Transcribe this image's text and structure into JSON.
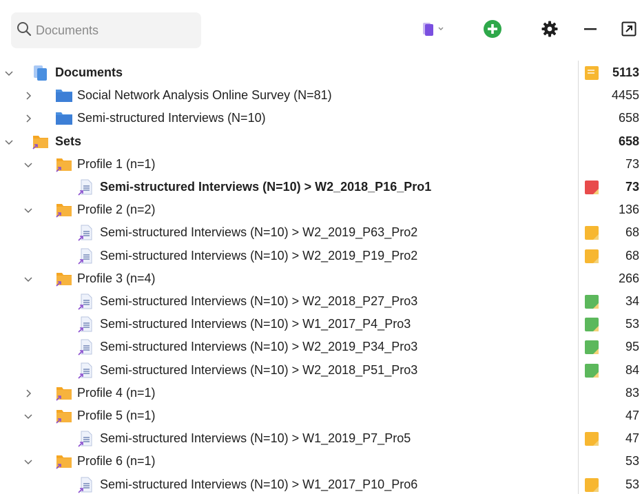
{
  "search": {
    "placeholder": "Documents"
  },
  "toolbar": {
    "doc_icon": "document-dropdown-icon",
    "add_icon": "add-circle-icon",
    "settings_icon": "gear-icon",
    "minimize_icon": "minus-icon",
    "popout_icon": "popout-icon"
  },
  "colors": {
    "folder_blue": "#4a8fe0",
    "folder_orange": "#f5a623",
    "memo_yellow": "#f7b731",
    "memo_red": "#e84b4b",
    "memo_green": "#5cb85c",
    "add_green": "#2ea84a",
    "link_purple": "#8b4fcf"
  },
  "tree": {
    "rows": [
      {
        "level": 0,
        "expand": "open",
        "icon": "documents",
        "label": "Documents",
        "count": "5113",
        "bold": true,
        "memo": "yellow"
      },
      {
        "level": 1,
        "expand": "closed",
        "icon": "folder-blue",
        "label": "Social Network Analysis Online Survey (N=81)",
        "count": "4455",
        "bold": false,
        "memo": ""
      },
      {
        "level": 1,
        "expand": "closed",
        "icon": "folder-blue",
        "label": "Semi-structured Interviews (N=10)",
        "count": "658",
        "bold": false,
        "memo": ""
      },
      {
        "level": 0,
        "expand": "open",
        "icon": "set",
        "label": "Sets",
        "count": "658",
        "bold": true,
        "memo": ""
      },
      {
        "level": 1,
        "expand": "open",
        "icon": "set",
        "label": "Profile 1 (n=1)",
        "count": "73",
        "bold": false,
        "memo": ""
      },
      {
        "level": 2,
        "expand": "",
        "icon": "doc",
        "label": "Semi-structured Interviews (N=10) > W2_2018_P16_Pro1",
        "count": "73",
        "bold": true,
        "memo": "red"
      },
      {
        "level": 1,
        "expand": "open",
        "icon": "set",
        "label": "Profile 2 (n=2)",
        "count": "136",
        "bold": false,
        "memo": ""
      },
      {
        "level": 2,
        "expand": "",
        "icon": "doc",
        "label": "Semi-structured Interviews (N=10) > W2_2019_P63_Pro2",
        "count": "68",
        "bold": false,
        "memo": "yellow"
      },
      {
        "level": 2,
        "expand": "",
        "icon": "doc",
        "label": "Semi-structured Interviews (N=10) > W2_2019_P19_Pro2",
        "count": "68",
        "bold": false,
        "memo": "yellow"
      },
      {
        "level": 1,
        "expand": "open",
        "icon": "set",
        "label": "Profile 3 (n=4)",
        "count": "266",
        "bold": false,
        "memo": ""
      },
      {
        "level": 2,
        "expand": "",
        "icon": "doc",
        "label": "Semi-structured Interviews (N=10) > W2_2018_P27_Pro3",
        "count": "34",
        "bold": false,
        "memo": "green"
      },
      {
        "level": 2,
        "expand": "",
        "icon": "doc",
        "label": "Semi-structured Interviews (N=10) > W1_2017_P4_Pro3",
        "count": "53",
        "bold": false,
        "memo": "green"
      },
      {
        "level": 2,
        "expand": "",
        "icon": "doc",
        "label": "Semi-structured Interviews (N=10) > W2_2019_P34_Pro3",
        "count": "95",
        "bold": false,
        "memo": "green"
      },
      {
        "level": 2,
        "expand": "",
        "icon": "doc",
        "label": "Semi-structured Interviews (N=10) > W2_2018_P51_Pro3",
        "count": "84",
        "bold": false,
        "memo": "green"
      },
      {
        "level": 1,
        "expand": "closed",
        "icon": "set",
        "label": "Profile 4 (n=1)",
        "count": "83",
        "bold": false,
        "memo": ""
      },
      {
        "level": 1,
        "expand": "open",
        "icon": "set",
        "label": "Profile 5 (n=1)",
        "count": "47",
        "bold": false,
        "memo": ""
      },
      {
        "level": 2,
        "expand": "",
        "icon": "doc",
        "label": "Semi-structured Interviews (N=10) > W1_2019_P7_Pro5",
        "count": "47",
        "bold": false,
        "memo": "yellow"
      },
      {
        "level": 1,
        "expand": "open",
        "icon": "set",
        "label": "Profile 6 (n=1)",
        "count": "53",
        "bold": false,
        "memo": ""
      },
      {
        "level": 2,
        "expand": "",
        "icon": "doc",
        "label": "Semi-structured Interviews (N=10) > W1_2017_P10_Pro6",
        "count": "53",
        "bold": false,
        "memo": "yellow"
      }
    ]
  }
}
